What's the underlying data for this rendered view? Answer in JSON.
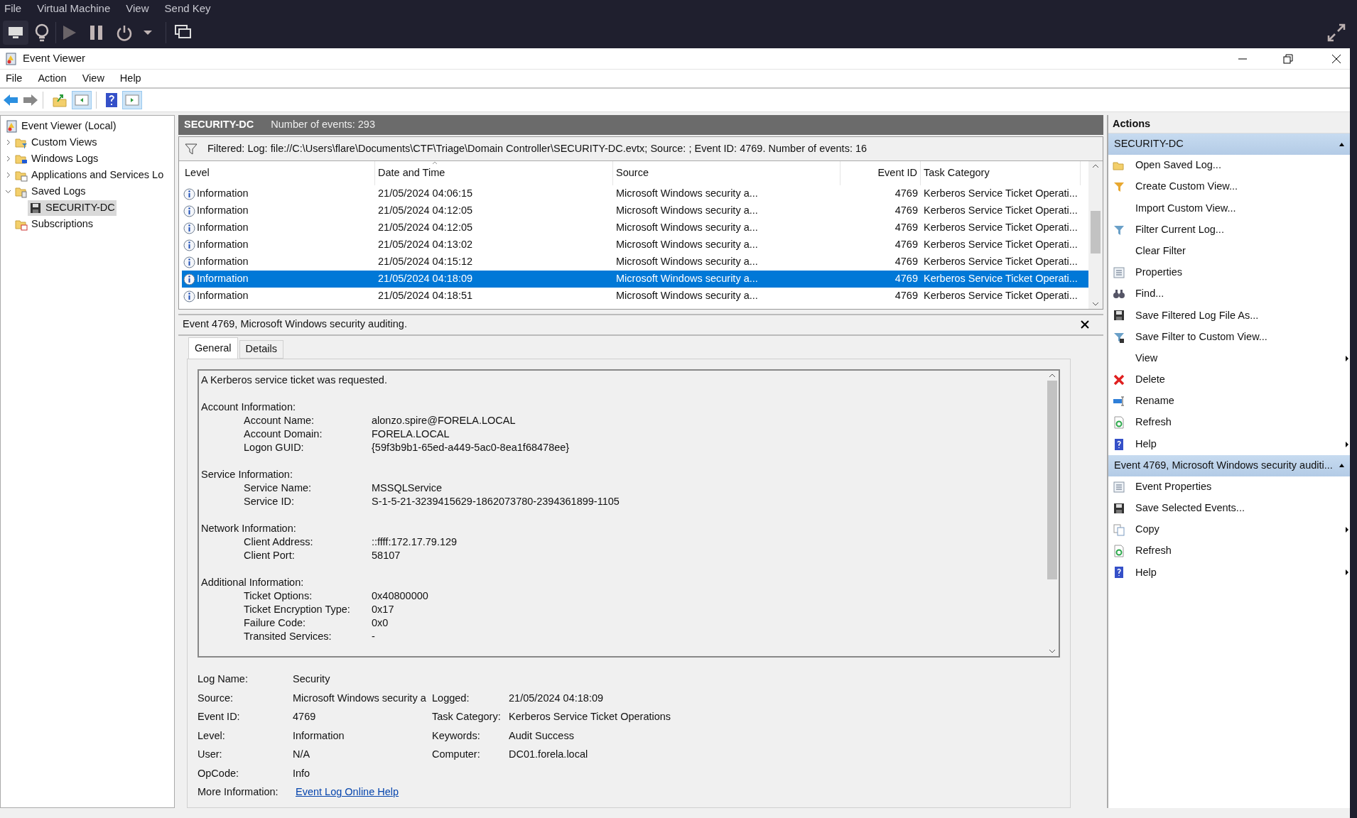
{
  "vm_menu": [
    "File",
    "Virtual Machine",
    "View",
    "Send Key"
  ],
  "window": {
    "title": "Event Viewer"
  },
  "menu": [
    "File",
    "Action",
    "View",
    "Help"
  ],
  "tree": [
    {
      "label": "Event Viewer (Local)",
      "selected": false,
      "children": [
        {
          "label": "Custom Views",
          "expanded": false,
          "selected": false
        },
        {
          "label": "Windows Logs",
          "expanded": false,
          "selected": false
        },
        {
          "label": "Applications and Services Lo",
          "expanded": false,
          "selected": false
        },
        {
          "label": "Saved Logs",
          "expanded": true,
          "selected": false,
          "children": [
            {
              "label": "SECURITY-DC",
              "selected": true
            }
          ]
        },
        {
          "label": "Subscriptions",
          "selected": false
        }
      ]
    }
  ],
  "log_header": {
    "name": "SECURITY-DC",
    "count": "Number of events: 293"
  },
  "filter": "Filtered: Log: file://C:\\Users\\flare\\Documents\\CTF\\Triage\\Domain Controller\\SECURITY-DC.evtx; Source: ; Event ID: 4769. Number of events: 16",
  "table": {
    "columns": [
      "Level",
      "Date and Time",
      "Source",
      "Event ID",
      "Task Category"
    ],
    "rows": [
      {
        "level": "Information",
        "date": "21/05/2024 04:06:15",
        "source": "Microsoft Windows security a...",
        "event_id": "4769",
        "category": "Kerberos Service Ticket Operati...",
        "selected": false
      },
      {
        "level": "Information",
        "date": "21/05/2024 04:12:05",
        "source": "Microsoft Windows security a...",
        "event_id": "4769",
        "category": "Kerberos Service Ticket Operati...",
        "selected": false
      },
      {
        "level": "Information",
        "date": "21/05/2024 04:12:05",
        "source": "Microsoft Windows security a...",
        "event_id": "4769",
        "category": "Kerberos Service Ticket Operati...",
        "selected": false
      },
      {
        "level": "Information",
        "date": "21/05/2024 04:13:02",
        "source": "Microsoft Windows security a...",
        "event_id": "4769",
        "category": "Kerberos Service Ticket Operati...",
        "selected": false
      },
      {
        "level": "Information",
        "date": "21/05/2024 04:15:12",
        "source": "Microsoft Windows security a...",
        "event_id": "4769",
        "category": "Kerberos Service Ticket Operati...",
        "selected": false
      },
      {
        "level": "Information",
        "date": "21/05/2024 04:18:09",
        "source": "Microsoft Windows security a...",
        "event_id": "4769",
        "category": "Kerberos Service Ticket Operati...",
        "selected": true
      },
      {
        "level": "Information",
        "date": "21/05/2024 04:18:51",
        "source": "Microsoft Windows security a...",
        "event_id": "4769",
        "category": "Kerberos Service Ticket Operati...",
        "selected": false
      }
    ]
  },
  "detail": {
    "title": "Event 4769, Microsoft Windows security auditing.",
    "tabs": [
      {
        "label": "General",
        "selected": true
      },
      {
        "label": "Details",
        "selected": false
      }
    ],
    "intro": "A Kerberos service ticket was requested.",
    "sections": [
      {
        "heading": "Account Information:",
        "fields": [
          {
            "label": "Account Name:",
            "value": "alonzo.spire@FORELA.LOCAL"
          },
          {
            "label": "Account Domain:",
            "value": "FORELA.LOCAL"
          },
          {
            "label": "Logon GUID:",
            "value": "{59f3b9b1-65ed-a449-5ac0-8ea1f68478ee}"
          }
        ]
      },
      {
        "heading": "Service Information:",
        "fields": [
          {
            "label": "Service Name:",
            "value": "MSSQLService"
          },
          {
            "label": "Service ID:",
            "value": "S-1-5-21-3239415629-1862073780-2394361899-1105"
          }
        ]
      },
      {
        "heading": "Network Information:",
        "fields": [
          {
            "label": "Client Address:",
            "value": "::ffff:172.17.79.129"
          },
          {
            "label": "Client Port:",
            "value": "58107"
          }
        ]
      },
      {
        "heading": "Additional Information:",
        "fields": [
          {
            "label": "Ticket Options:",
            "value": "0x40800000"
          },
          {
            "label": "Ticket Encryption Type:",
            "value": "0x17"
          },
          {
            "label": "Failure Code:",
            "value": "0x0"
          },
          {
            "label": "Transited Services:",
            "value": "-"
          }
        ]
      }
    ],
    "properties_left": [
      {
        "label": "Log Name:",
        "value": "Security"
      },
      {
        "label": "Source:",
        "value": "Microsoft Windows security a"
      },
      {
        "label": "Event ID:",
        "value": "4769"
      },
      {
        "label": "Level:",
        "value": "Information"
      },
      {
        "label": "User:",
        "value": "N/A"
      },
      {
        "label": "OpCode:",
        "value": "Info"
      }
    ],
    "properties_right": [
      {
        "label": "Logged:",
        "value": "21/05/2024 04:18:09"
      },
      {
        "label": "Task Category:",
        "value": "Kerberos Service Ticket Operations"
      },
      {
        "label": "Keywords:",
        "value": "Audit Success"
      },
      {
        "label": "Computer:",
        "value": "DC01.forela.local"
      }
    ],
    "more_info": {
      "label": "More Information:",
      "link": "Event Log Online Help"
    }
  },
  "actions": {
    "title": "Actions",
    "groups": [
      {
        "title": "SECURITY-DC",
        "expanded": true,
        "items": [
          {
            "label": "Open Saved Log...",
            "submenu": false
          },
          {
            "label": "Create Custom View...",
            "submenu": false
          },
          {
            "label": "Import Custom View...",
            "submenu": false
          },
          {
            "label": "Filter Current Log...",
            "submenu": false
          },
          {
            "label": "Clear Filter",
            "submenu": false
          },
          {
            "label": "Properties",
            "submenu": false
          },
          {
            "label": "Find...",
            "submenu": false
          },
          {
            "label": "Save Filtered Log File As...",
            "submenu": false
          },
          {
            "label": "Save Filter to Custom View...",
            "submenu": false
          },
          {
            "label": "View",
            "submenu": true
          },
          {
            "label": "Delete",
            "submenu": false
          },
          {
            "label": "Rename",
            "submenu": false
          },
          {
            "label": "Refresh",
            "submenu": false
          },
          {
            "label": "Help",
            "submenu": true
          }
        ]
      },
      {
        "title": "Event 4769, Microsoft Windows security auditi...",
        "expanded": true,
        "items": [
          {
            "label": "Event Properties",
            "submenu": false
          },
          {
            "label": "Save Selected Events...",
            "submenu": false
          },
          {
            "label": "Copy",
            "submenu": true
          },
          {
            "label": "Refresh",
            "submenu": false
          },
          {
            "label": "Help",
            "submenu": true
          }
        ]
      }
    ]
  }
}
